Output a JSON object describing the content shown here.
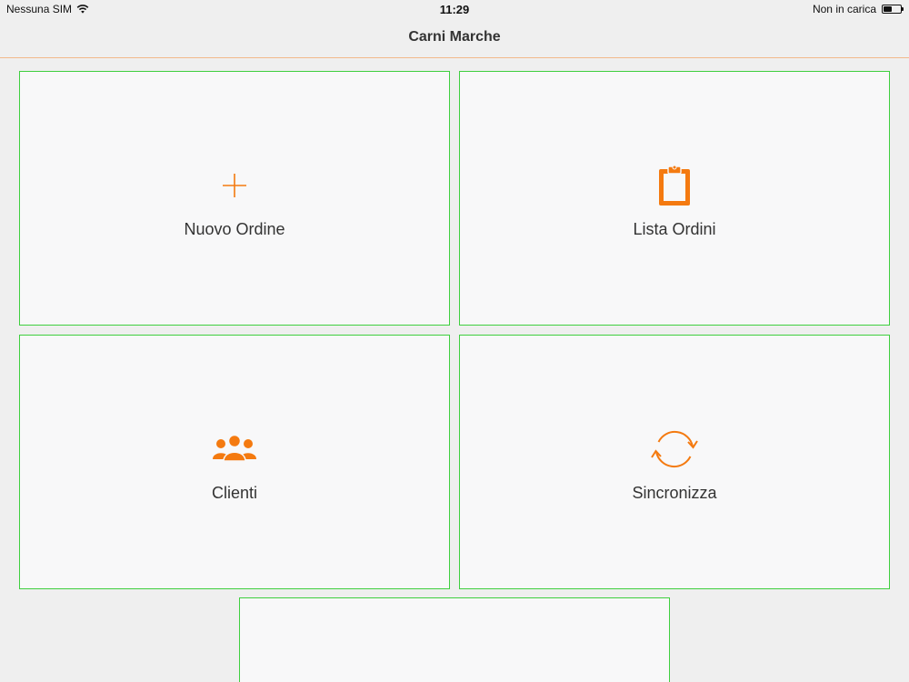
{
  "status_bar": {
    "carrier": "Nessuna SIM",
    "time": "11:29",
    "battery_status": "Non in carica"
  },
  "nav": {
    "title": "Carni Marche"
  },
  "tiles": [
    {
      "label": "Nuovo Ordine",
      "icon": "plus-icon"
    },
    {
      "label": "Lista Ordini",
      "icon": "clipboard-icon"
    },
    {
      "label": "Clienti",
      "icon": "users-icon"
    },
    {
      "label": "Sincronizza",
      "icon": "sync-icon"
    }
  ],
  "colors": {
    "accent": "#f47a10",
    "tile_border": "#3fcf3f",
    "tile_background": "#f8f8f9",
    "page_background": "#efefef"
  }
}
